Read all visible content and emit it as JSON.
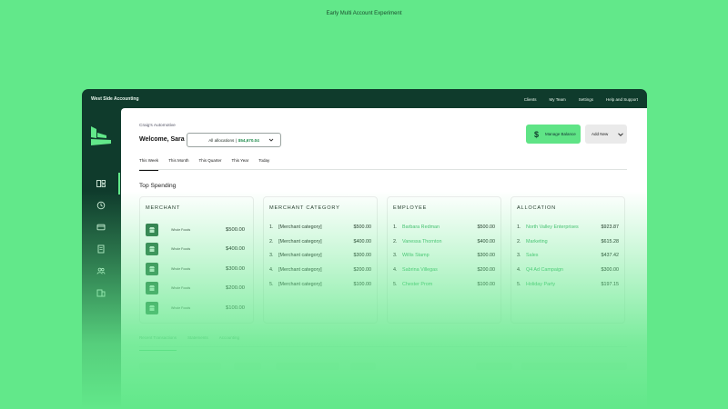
{
  "caption": "Early Multi Account Experiment",
  "app": {
    "brand": "West Side Accounting",
    "nav": [
      "Clients",
      "My Team",
      "Settings",
      "Help and Support"
    ]
  },
  "sidebar": {
    "accent": "#62e88a",
    "items": [
      {
        "icon": "dashboard-icon",
        "active": true
      },
      {
        "icon": "clock-icon",
        "active": false
      },
      {
        "icon": "card-icon",
        "active": false
      },
      {
        "icon": "receipt-icon",
        "active": false
      },
      {
        "icon": "users-icon",
        "active": false
      },
      {
        "icon": "building-icon",
        "active": false
      }
    ]
  },
  "header": {
    "company": "Craig's Automotive",
    "welcome": "Welcome, Sara",
    "allocations_label": "All allocations |",
    "allocations_amount": "$54,670.04",
    "manage_label": "Manage Balance",
    "add_new_label": "Add New"
  },
  "period_tabs": [
    "This Week",
    "This Month",
    "This Quarter",
    "This Year",
    "Today"
  ],
  "section_title": "Top Spending",
  "cards": {
    "merchant": {
      "title": "MERCHANT",
      "rows": [
        {
          "name": "Whole Foods",
          "amount": "$500.00"
        },
        {
          "name": "Whole Foods",
          "amount": "$400.00"
        },
        {
          "name": "Whole Foods",
          "amount": "$300.00"
        },
        {
          "name": "Whole Foods",
          "amount": "$200.00"
        },
        {
          "name": "Whole Foods",
          "amount": "$100.00"
        }
      ]
    },
    "category": {
      "title": "MERCHANT CATEGORY",
      "rows": [
        {
          "num": "1.",
          "name": "[Merchant category]",
          "amount": "$500.00"
        },
        {
          "num": "2.",
          "name": "[Merchant category]",
          "amount": "$400.00"
        },
        {
          "num": "3.",
          "name": "[Merchant category]",
          "amount": "$300.00"
        },
        {
          "num": "4.",
          "name": "[Merchant category]",
          "amount": "$200.00"
        },
        {
          "num": "5.",
          "name": "[Merchant category]",
          "amount": "$100.00"
        }
      ]
    },
    "employee": {
      "title": "EMPLOYEE",
      "rows": [
        {
          "num": "1.",
          "name": "Barbara Redman",
          "amount": "$500.00"
        },
        {
          "num": "2.",
          "name": "Vanessa Thornton",
          "amount": "$400.00"
        },
        {
          "num": "3.",
          "name": "Willis Stamp",
          "amount": "$300.00"
        },
        {
          "num": "4.",
          "name": "Sabrina Villegas",
          "amount": "$200.00"
        },
        {
          "num": "5.",
          "name": "Chester Prom",
          "amount": "$100.00"
        }
      ]
    },
    "allocation": {
      "title": "ALLOCATION",
      "rows": [
        {
          "num": "1.",
          "name": "North Valley Enterprises",
          "amount": "$923.87"
        },
        {
          "num": "2.",
          "name": "Marketing",
          "amount": "$615.28"
        },
        {
          "num": "3.",
          "name": "Sales",
          "amount": "$437.42"
        },
        {
          "num": "4.",
          "name": "Q4 Ad Campaign",
          "amount": "$300.00"
        },
        {
          "num": "5.",
          "name": "Holiday Party",
          "amount": "$197.15"
        }
      ]
    }
  },
  "bottom_tabs": [
    "Recent Transactions",
    "Statements",
    "Accounting"
  ]
}
